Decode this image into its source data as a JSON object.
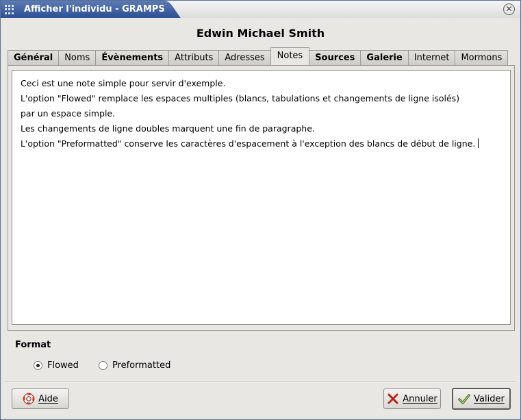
{
  "window": {
    "title": "Afficher l'individu - GRAMPS",
    "close_glyph": "✕"
  },
  "person": {
    "name": "Edwin Michael Smith"
  },
  "tabs": [
    {
      "label": "Général",
      "bold": true,
      "active": false
    },
    {
      "label": "Noms",
      "bold": false,
      "active": false
    },
    {
      "label": "Évènements",
      "bold": true,
      "active": false
    },
    {
      "label": "Attributs",
      "bold": false,
      "active": false
    },
    {
      "label": "Adresses",
      "bold": false,
      "active": false
    },
    {
      "label": "Notes",
      "bold": false,
      "active": true
    },
    {
      "label": "Sources",
      "bold": true,
      "active": false
    },
    {
      "label": "Galerie",
      "bold": true,
      "active": false
    },
    {
      "label": "Internet",
      "bold": false,
      "active": false
    },
    {
      "label": "Mormons",
      "bold": false,
      "active": false
    }
  ],
  "note": {
    "lines": [
      "Ceci est une note simple pour servir d'exemple.",
      "L'option \"Flowed\" remplace les espaces multiples (blancs, tabulations et changements de ligne isolés)",
      "par un espace simple.",
      "Les changements de ligne doubles marquent une fin de paragraphe.",
      "L'option \"Preformatted\" conserve les caractères d'espacement à l'exception des blancs de début de ligne."
    ]
  },
  "format": {
    "label": "Format",
    "options": [
      {
        "label": "Flowed",
        "selected": true
      },
      {
        "label": "Preformatted",
        "selected": false
      }
    ]
  },
  "buttons": {
    "help": "Aide",
    "cancel": "Annuler",
    "ok": "Valider"
  },
  "icons": {
    "help": "lifebuoy-icon",
    "cancel": "red-x-icon",
    "ok": "checkmark-icon",
    "window": "gramps-window-icon"
  }
}
